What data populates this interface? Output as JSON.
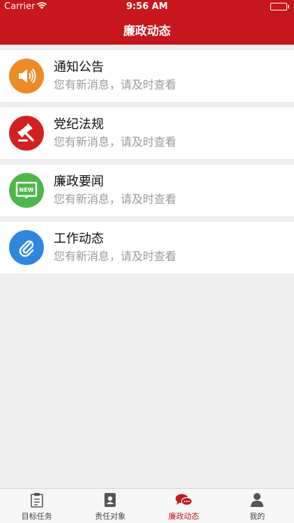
{
  "status_bar": {
    "carrier": "Carrier",
    "time": "9:56 AM",
    "battery_level": 1.0
  },
  "header": {
    "title": "廉政动态"
  },
  "items": [
    {
      "title": "通知公告",
      "subtitle": "您有新消息，请及时查看",
      "icon": "speaker-icon",
      "color": "#f08a24"
    },
    {
      "title": "党纪法规",
      "subtitle": "您有新消息，请及时查看",
      "icon": "gavel-icon",
      "color": "#d4201e"
    },
    {
      "title": "廉政要闻",
      "subtitle": "您有新消息，请及时查看",
      "icon": "news-icon",
      "badge": "NEW",
      "color": "#4cb848"
    },
    {
      "title": "工作动态",
      "subtitle": "您有新消息，请及时查看",
      "icon": "paperclip-icon",
      "color": "#2e86de"
    }
  ],
  "tabs": [
    {
      "label": "目标任务",
      "icon": "clipboard-icon",
      "active": false
    },
    {
      "label": "责任对象",
      "icon": "contacts-icon",
      "active": false
    },
    {
      "label": "廉政动态",
      "icon": "chat-bubbles-icon",
      "active": true
    },
    {
      "label": "我的",
      "icon": "user-icon",
      "active": false
    }
  ],
  "colors": {
    "primary": "#c8161d",
    "background": "#eeeeee",
    "subtitle_text": "#9a9a9a"
  }
}
